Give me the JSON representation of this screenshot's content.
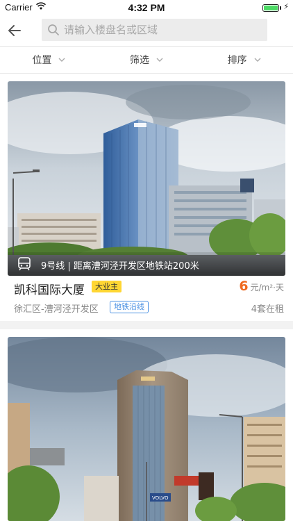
{
  "status_bar": {
    "carrier": "Carrier",
    "time": "4:32 PM",
    "battery_level": 1.0
  },
  "search": {
    "placeholder": "请输入楼盘名或区域"
  },
  "filters": [
    {
      "label": "位置"
    },
    {
      "label": "筛选"
    },
    {
      "label": "排序"
    }
  ],
  "listings": [
    {
      "metro_info": "9号线 | 距离漕河泾开发区地铁站200米",
      "name": "凯科国际大厦",
      "owner_badge": "大业主",
      "price": "6",
      "price_unit": "元/m²·天",
      "district": "徐汇区-漕河泾开发区",
      "metro_badge": "地铁沿线",
      "available": "4套在租"
    },
    {
      "sign_text": "VOLVO"
    }
  ],
  "colors": {
    "price": "#ef6a1f",
    "owner_badge_bg": "#ffd633",
    "metro_badge": "#4a90e2",
    "battery": "#4cd964"
  }
}
